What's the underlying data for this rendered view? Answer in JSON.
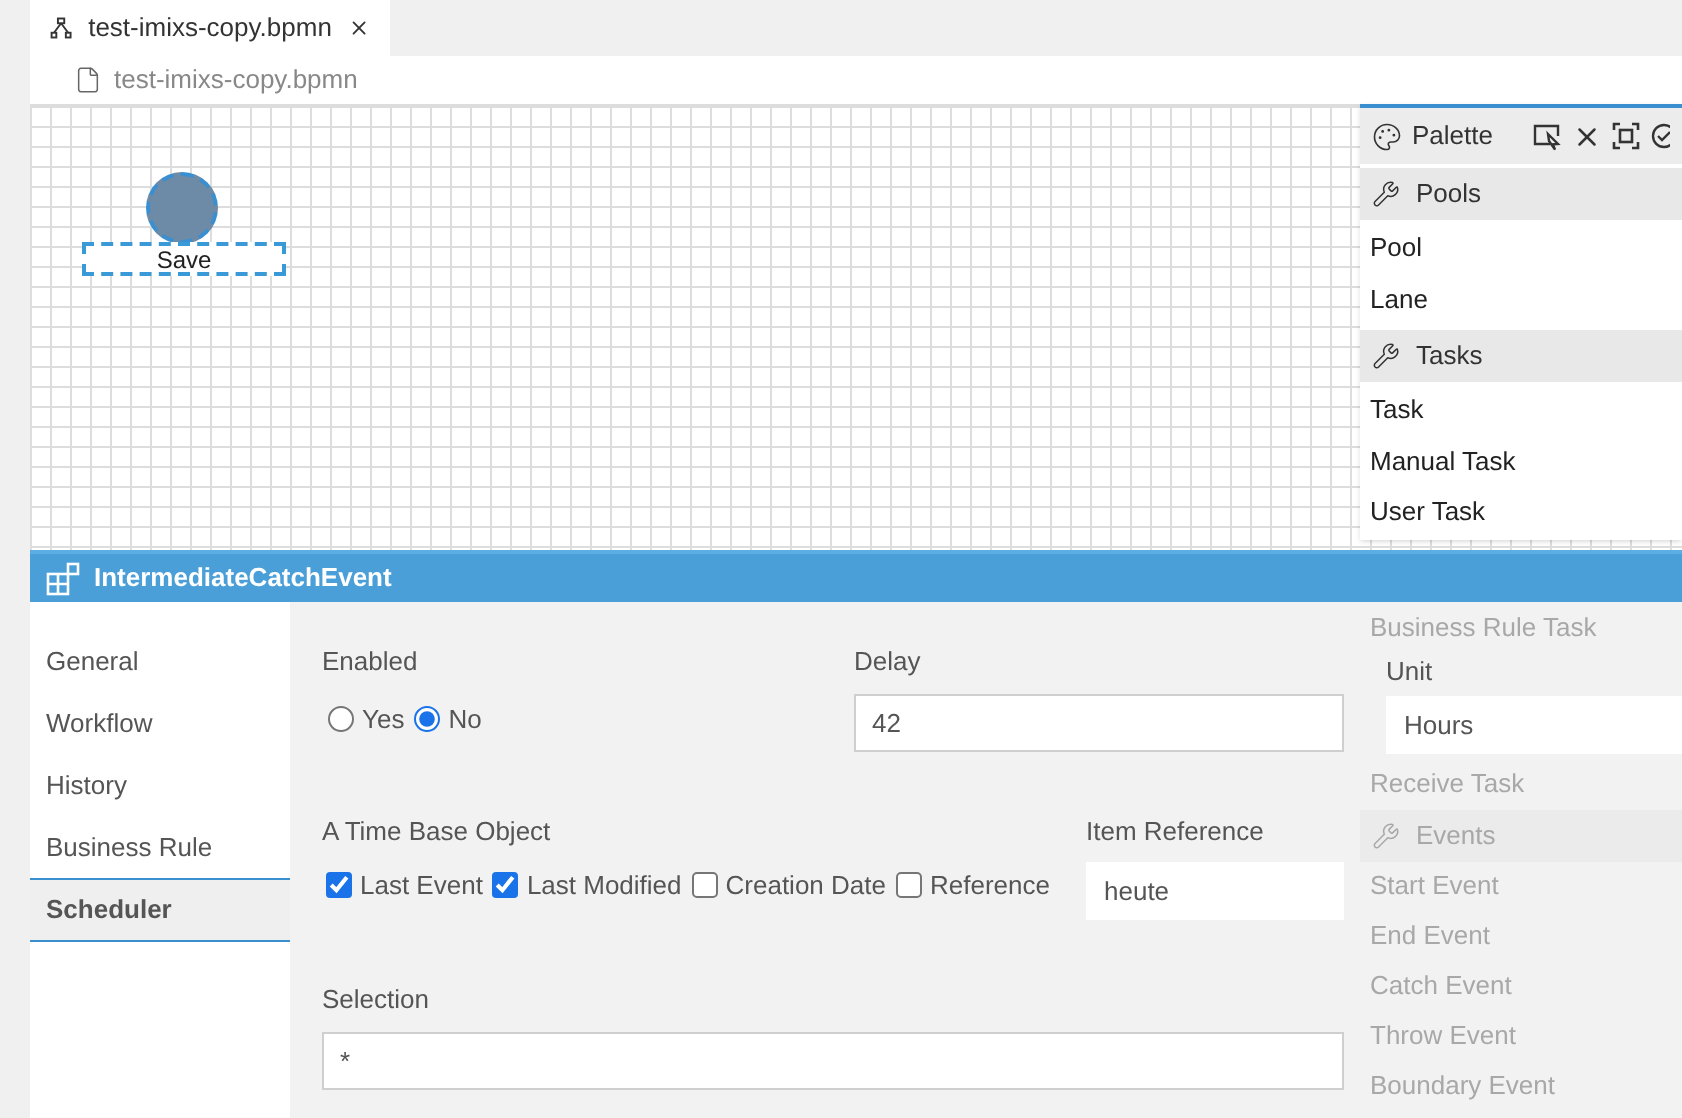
{
  "editor_tab": {
    "title": "test-imixs-copy.bpmn"
  },
  "breadcrumb": {
    "file": "test-imixs-copy.bpmn"
  },
  "diagram": {
    "event_label": "Save"
  },
  "palette": {
    "title": "Palette",
    "groups": [
      {
        "title": "Pools",
        "items": [
          "Pool",
          "Lane"
        ]
      },
      {
        "title": "Tasks",
        "items": [
          "Task",
          "Manual Task",
          "User Task"
        ]
      }
    ],
    "faded_items": [
      {
        "kind": "item",
        "label": "Business Rule Task"
      },
      {
        "kind": "item",
        "label": "Receive Task"
      },
      {
        "kind": "group",
        "label": "Events"
      },
      {
        "kind": "item",
        "label": "Start Event"
      },
      {
        "kind": "item",
        "label": "End Event"
      },
      {
        "kind": "item",
        "label": "Catch Event"
      },
      {
        "kind": "item",
        "label": "Throw Event"
      },
      {
        "kind": "item",
        "label": "Boundary Event"
      }
    ]
  },
  "properties": {
    "title": "IntermediateCatchEvent",
    "nav": [
      {
        "label": "General",
        "selected": false
      },
      {
        "label": "Workflow",
        "selected": false
      },
      {
        "label": "History",
        "selected": false
      },
      {
        "label": "Business Rule",
        "selected": false
      },
      {
        "label": "Scheduler",
        "selected": true
      }
    ],
    "enabled": {
      "label": "Enabled",
      "options": [
        {
          "label": "Yes",
          "selected": false
        },
        {
          "label": "No",
          "selected": true
        }
      ]
    },
    "delay": {
      "label": "Delay",
      "value": "42"
    },
    "unit": {
      "label": "Unit",
      "value": "Hours"
    },
    "time_base": {
      "label": "A Time Base Object",
      "options": [
        {
          "label": "Last Event",
          "checked": true
        },
        {
          "label": "Last Modified",
          "checked": true
        },
        {
          "label": "Creation Date",
          "checked": false
        },
        {
          "label": "Reference",
          "checked": false
        }
      ]
    },
    "item_reference": {
      "label": "Item Reference",
      "value": "heute"
    },
    "selection": {
      "label": "Selection",
      "value": "*"
    }
  }
}
